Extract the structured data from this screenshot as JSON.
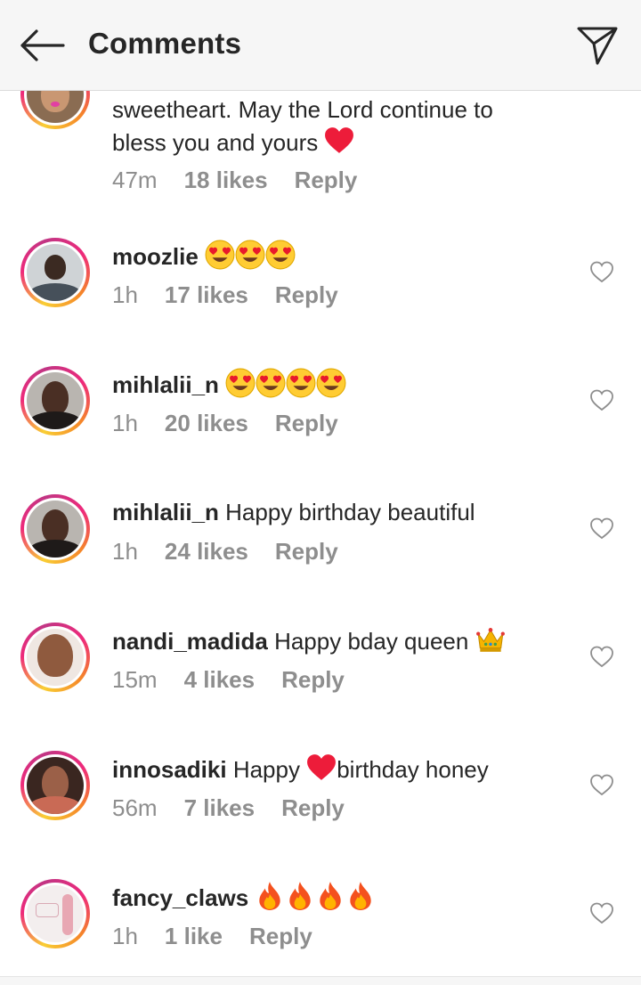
{
  "header": {
    "title": "Comments",
    "back_icon": "arrow-left-icon",
    "share_icon": "paper-plane-icon"
  },
  "colors": {
    "text": "#262626",
    "meta": "#8e8e8e",
    "header_bg": "#f6f6f6",
    "heart_red": "#ed1c3a"
  },
  "comments": [
    {
      "username": "",
      "text_line1": "sweetheart. May the Lord continue to",
      "text_line2": "bless you and yours",
      "emoji": "red-heart",
      "time": "47m",
      "likes": "18 likes",
      "reply": "Reply"
    },
    {
      "username": "moozlie",
      "text": "",
      "emoji": "heart-eyes x3",
      "time": "1h",
      "likes": "17 likes",
      "reply": "Reply"
    },
    {
      "username": "mihlalii_n",
      "text": "",
      "emoji": "heart-eyes x4",
      "time": "1h",
      "likes": "20 likes",
      "reply": "Reply"
    },
    {
      "username": "mihlalii_n",
      "text": "Happy birthday beautiful",
      "time": "1h",
      "likes": "24 likes",
      "reply": "Reply"
    },
    {
      "username": "nandi_madida",
      "text": "Happy bday queen",
      "emoji": "crown",
      "time": "15m",
      "likes": "4 likes",
      "reply": "Reply"
    },
    {
      "username": "innosadiki",
      "text_before": "Happy",
      "text_after": "birthday honey",
      "emoji": "red-heart",
      "time": "56m",
      "likes": "7 likes",
      "reply": "Reply"
    },
    {
      "username": "fancy_claws",
      "text": "",
      "emoji": "fire x4",
      "time": "1h",
      "likes": "1 like",
      "reply": "Reply"
    }
  ]
}
